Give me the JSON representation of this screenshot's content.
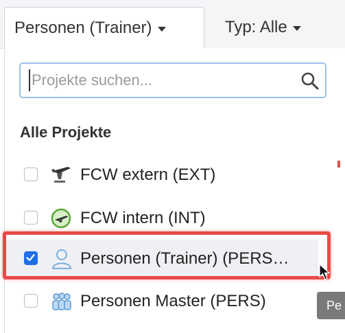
{
  "tabs": {
    "project_filter": "Personen (Trainer)",
    "type_filter": "Typ: Alle"
  },
  "search": {
    "placeholder": "Projekte suchen...",
    "value": ""
  },
  "section_title": "Alle Projekte",
  "projects": [
    {
      "label": "FCW extern (EXT)",
      "checked": false,
      "icon": "airplane-icon"
    },
    {
      "label": "FCW intern (INT)",
      "checked": false,
      "icon": "airplane-circle-icon"
    },
    {
      "label": "Personen (Trainer) (PERS…",
      "checked": true,
      "icon": "person-icon"
    },
    {
      "label": "Personen Master (PERS)",
      "checked": false,
      "icon": "people-group-icon"
    }
  ],
  "tooltip": "Pe",
  "colors": {
    "accent": "#1e6ee8",
    "highlight": "#e84a47"
  }
}
